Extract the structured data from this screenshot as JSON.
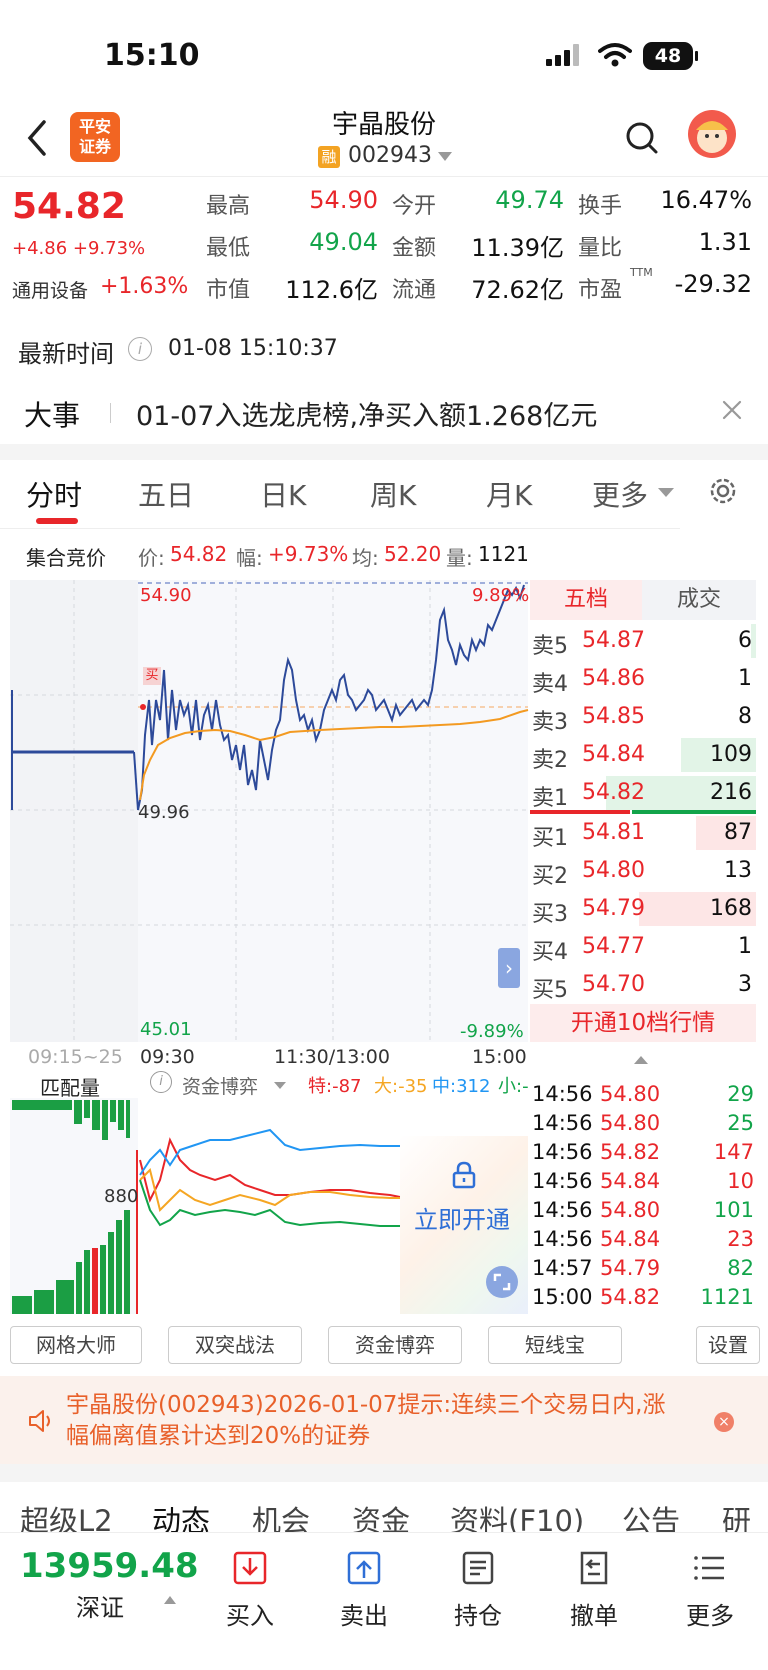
{
  "status_bar": {
    "time": "15:10",
    "battery": "48"
  },
  "header": {
    "stock_name": "宇晶股份",
    "margin_badge": "融",
    "stock_code": "002943",
    "logo_text_1": "平安",
    "logo_text_2": "证券"
  },
  "quote": {
    "price": "54.82",
    "change": "+4.86 +9.73%",
    "sector_name": "通用设备",
    "sector_change": "+1.63%",
    "fields": [
      {
        "label": "最高",
        "value": "54.90",
        "color": "red"
      },
      {
        "label": "今开",
        "value": "49.74",
        "color": "green"
      },
      {
        "label": "换手",
        "value": "16.47%",
        "color": "black"
      },
      {
        "label": "最低",
        "value": "49.04",
        "color": "green"
      },
      {
        "label": "金额",
        "value": "11.39亿",
        "color": "black"
      },
      {
        "label": "量比",
        "value": "1.31",
        "color": "black"
      },
      {
        "label": "市值",
        "value": "112.6亿",
        "color": "black"
      },
      {
        "label": "流通",
        "value": "72.62亿",
        "color": "black"
      },
      {
        "label": "市盈",
        "value": "-29.32",
        "color": "black",
        "superscript": "TTM"
      }
    ]
  },
  "update": {
    "label": "最新时间",
    "info_icon": "i",
    "value": "01-08 15:10:37"
  },
  "event": {
    "label": "大事",
    "text": "01-07入选龙虎榜,净买入额1.268亿元"
  },
  "tabs": [
    "分时",
    "五日",
    "日K",
    "周K",
    "月K",
    "更多"
  ],
  "auction": {
    "label": "集合竞价",
    "items": [
      {
        "label": "价:",
        "value": "54.82"
      },
      {
        "label": "幅:",
        "value": "+9.73%"
      },
      {
        "label": "均:",
        "value": "52.20"
      },
      {
        "label": "量:",
        "value": "1121"
      }
    ]
  },
  "chart": {
    "price_high": "54.90",
    "pct_high": "9.89%",
    "price_mid": "49.96",
    "price_low": "45.01",
    "pct_low": "-9.89%",
    "buy_marker": "买",
    "expand": "›",
    "time_axis": [
      "09:15~25",
      "09:30",
      "11:30/13:00",
      "15:00"
    ],
    "volume_label": "匹配量",
    "volume_level": "880",
    "capital": {
      "label": "资金博弈",
      "info_icon": "i",
      "items": [
        {
          "label": "特:",
          "value": "-87",
          "color": "#e8262a"
        },
        {
          "label": "大:",
          "value": "-35",
          "color": "#f5a623"
        },
        {
          "label": "中:",
          "value": "312",
          "color": "#2196f3"
        },
        {
          "label": "小:",
          "value": "-",
          "color": "#12a44a"
        }
      ]
    },
    "unlock_text": "立即开通"
  },
  "order_book": {
    "tabs": [
      "五档",
      "成交"
    ],
    "asks": [
      {
        "label": "卖5",
        "price": "54.87",
        "volume": "6",
        "bar": 0.03
      },
      {
        "label": "卖4",
        "price": "54.86",
        "volume": "1",
        "bar": 0.0
      },
      {
        "label": "卖3",
        "price": "54.85",
        "volume": "8",
        "bar": 0.0
      },
      {
        "label": "卖2",
        "price": "54.84",
        "volume": "109",
        "bar": 0.5
      },
      {
        "label": "卖1",
        "price": "54.82",
        "volume": "216",
        "bar": 1.0
      }
    ],
    "bids": [
      {
        "label": "买1",
        "price": "54.81",
        "volume": "87",
        "bar": 0.4
      },
      {
        "label": "买2",
        "price": "54.80",
        "volume": "13",
        "bar": 0.0
      },
      {
        "label": "买3",
        "price": "54.79",
        "volume": "168",
        "bar": 0.78
      },
      {
        "label": "买4",
        "price": "54.77",
        "volume": "1",
        "bar": 0.0
      },
      {
        "label": "买5",
        "price": "54.70",
        "volume": "3",
        "bar": 0.0
      }
    ],
    "upgrade_button": "开通10档行情"
  },
  "trades": [
    {
      "time": "14:56",
      "price": "54.80",
      "volume": "29",
      "color": "green"
    },
    {
      "time": "14:56",
      "price": "54.80",
      "volume": "25",
      "color": "green"
    },
    {
      "time": "14:56",
      "price": "54.82",
      "volume": "147",
      "color": "red"
    },
    {
      "time": "14:56",
      "price": "54.84",
      "volume": "10",
      "color": "red"
    },
    {
      "time": "14:56",
      "price": "54.80",
      "volume": "101",
      "color": "green"
    },
    {
      "time": "14:56",
      "price": "54.84",
      "volume": "23",
      "color": "red"
    },
    {
      "time": "14:57",
      "price": "54.79",
      "volume": "82",
      "color": "green"
    },
    {
      "time": "15:00",
      "price": "54.82",
      "volume": "1121",
      "color": "green"
    }
  ],
  "tools": [
    "网格大师",
    "双突战法",
    "资金博弈",
    "短线宝",
    "设置"
  ],
  "notice": {
    "text": "宇晶股份(002943)2026-01-07提示:连续三个交易日内,涨幅偏离值累计达到20%的证券",
    "close": "×"
  },
  "bottom_tabs": [
    "超级L2",
    "动态",
    "机会",
    "资金",
    "资料(F10)",
    "公告",
    "研报"
  ],
  "bottom_bar": {
    "index_value": "13959.48",
    "index_name": "深证",
    "nav": [
      {
        "label": "买入",
        "icon": "buy-icon"
      },
      {
        "label": "卖出",
        "icon": "sell-icon"
      },
      {
        "label": "持仓",
        "icon": "holdings-icon"
      },
      {
        "label": "撤单",
        "icon": "cancel-order-icon"
      },
      {
        "label": "更多",
        "icon": "menu-icon"
      }
    ]
  }
}
